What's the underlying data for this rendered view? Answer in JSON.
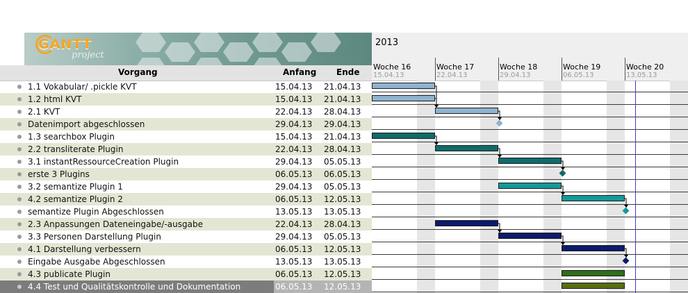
{
  "app": {
    "logo_text": "GANTT",
    "logo_sub": "project"
  },
  "table": {
    "columns": {
      "name": "Vorgang",
      "start": "Anfang",
      "end": "Ende"
    },
    "rows": [
      {
        "name": "1.1 Vokabular/ .pickle KVT",
        "start": "15.04.13",
        "end": "21.04.13"
      },
      {
        "name": "1.2 html KVT",
        "start": "15.04.13",
        "end": "21.04.13"
      },
      {
        "name": "2.1 KVT",
        "start": "22.04.13",
        "end": "28.04.13"
      },
      {
        "name": "Datenimport abgeschlossen",
        "start": "29.04.13",
        "end": "29.04.13"
      },
      {
        "name": "1.3 searchbox Plugin",
        "start": "15.04.13",
        "end": "21.04.13"
      },
      {
        "name": "2.2 transliterate Plugin",
        "start": "22.04.13",
        "end": "28.04.13"
      },
      {
        "name": "3.1 instantRessourceCreation Plugin",
        "start": "29.04.13",
        "end": "05.05.13"
      },
      {
        "name": "erste 3 Plugins",
        "start": "06.05.13",
        "end": "06.05.13"
      },
      {
        "name": "3.2 semantize Plugin 1",
        "start": "29.04.13",
        "end": "05.05.13"
      },
      {
        "name": "4.2 semantize Plugin 2",
        "start": "06.05.13",
        "end": "12.05.13"
      },
      {
        "name": "semantize Plugin Abgeschlossen",
        "start": "13.05.13",
        "end": "13.05.13"
      },
      {
        "name": "2.3 Anpassungen Dateneingabe/-ausgabe",
        "start": "22.04.13",
        "end": "28.04.13"
      },
      {
        "name": "3.3 Personen Darstellung Plugin",
        "start": "29.04.13",
        "end": "05.05.13"
      },
      {
        "name": "4.1 Darstellung verbessern",
        "start": "06.05.13",
        "end": "12.05.13"
      },
      {
        "name": "Eingabe Ausgabe Abgeschlossen",
        "start": "13.05.13",
        "end": "13.05.13"
      },
      {
        "name": "4.3 publicate Plugin",
        "start": "06.05.13",
        "end": "12.05.13"
      },
      {
        "name": "4.4 Test und Qualitätskontrolle und Dokumentation",
        "start": "06.05.13",
        "end": "12.05.13"
      }
    ]
  },
  "chart": {
    "year": "2013",
    "weeks": [
      {
        "label": "Woche 16",
        "date": "15.04.13"
      },
      {
        "label": "Woche 17",
        "date": "22.04.13"
      },
      {
        "label": "Woche 18",
        "date": "29.04.13"
      },
      {
        "label": "Woche 19",
        "date": "06.05.13"
      },
      {
        "label": "Woche 20",
        "date": "13.05.13"
      }
    ],
    "colors": {
      "light_blue": "#8fb3cf",
      "teal_dark": "#0f6b6b",
      "teal": "#13999a",
      "navy": "#0a1a6e",
      "green": "#2f6e18",
      "olive": "#5a6e10",
      "row_alt": "#e4e6d4",
      "today_line": "#3c3ccf"
    }
  }
}
